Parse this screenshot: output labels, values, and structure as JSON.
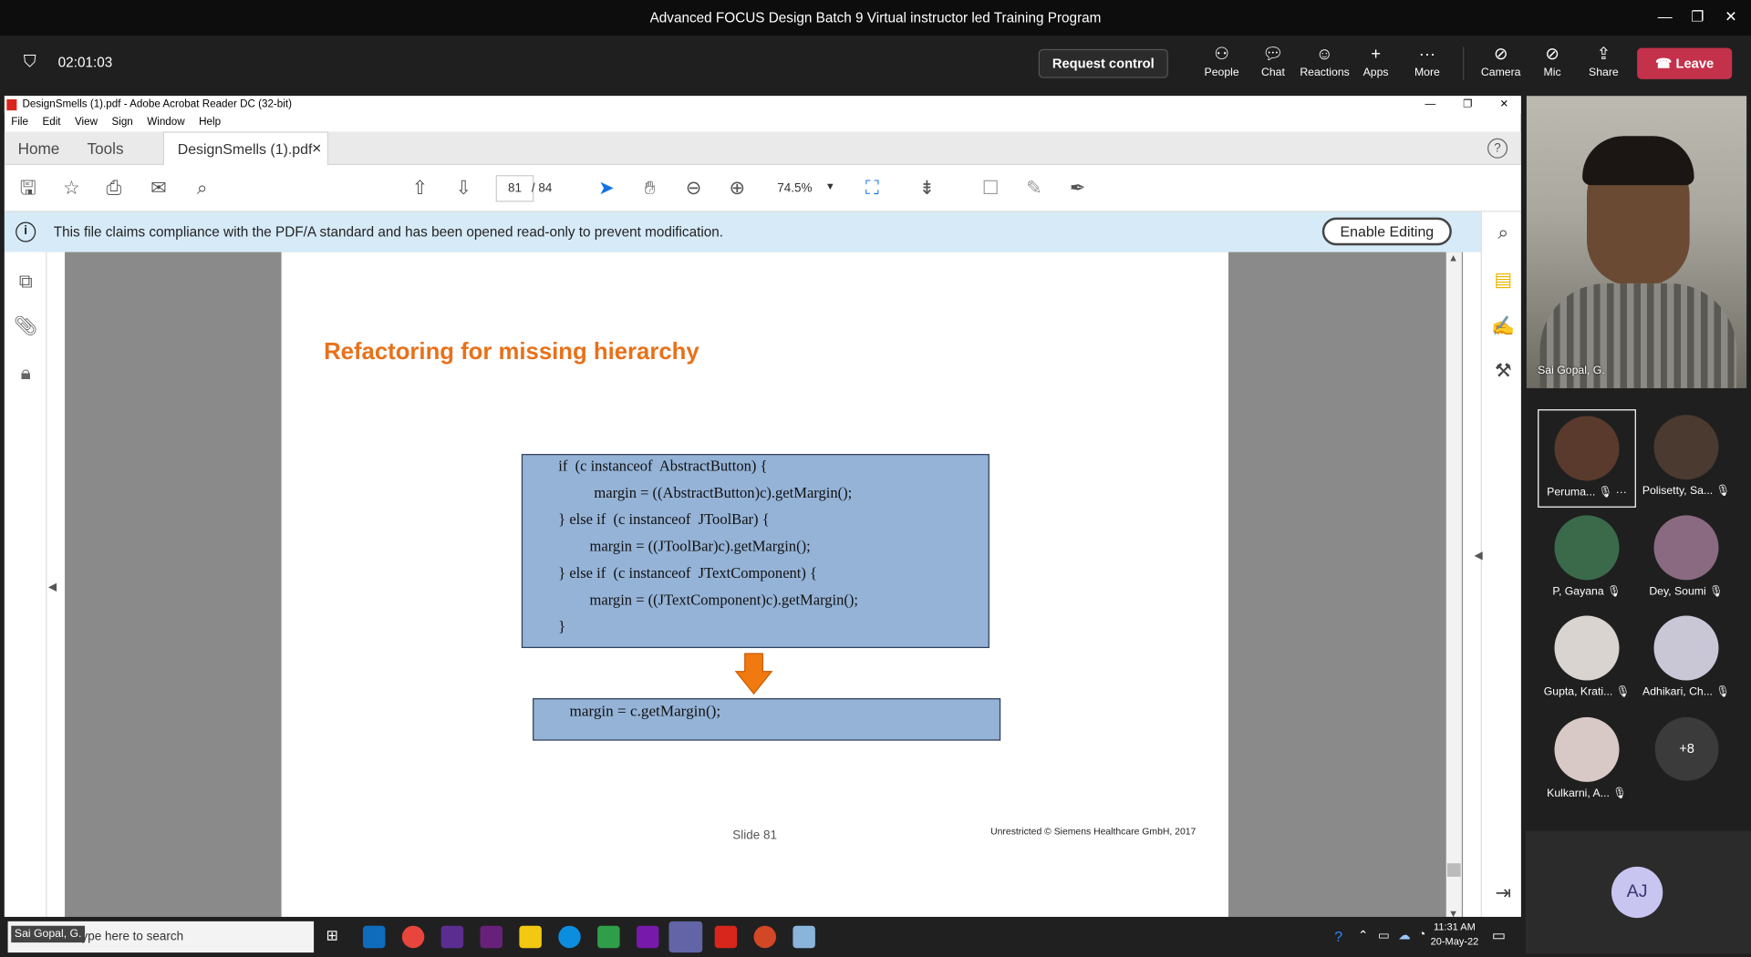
{
  "teams": {
    "window_title": "Advanced FOCUS Design Batch 9 Virtual instructor led Training Program",
    "timer": "02:01:03",
    "request_control": "Request control",
    "toolbar": {
      "people": "People",
      "chat": "Chat",
      "reactions": "Reactions",
      "apps": "Apps",
      "more": "More",
      "camera": "Camera",
      "mic": "Mic",
      "share": "Share",
      "leave": "Leave"
    }
  },
  "acrobat": {
    "title": "DesignSmells (1).pdf - Adobe Acrobat Reader DC (32-bit)",
    "menu": [
      "File",
      "Edit",
      "View",
      "Sign",
      "Window",
      "Help"
    ],
    "tabs": {
      "home": "Home",
      "tools": "Tools",
      "doc": "DesignSmells (1).pdf"
    },
    "page_current": "81",
    "page_total": "/ 84",
    "zoom": "74.5%",
    "notice": "This file claims compliance with the PDF/A standard and has been opened read-only to prevent modification.",
    "enable_editing": "Enable Editing"
  },
  "slide": {
    "title": "Refactoring for missing hierarchy",
    "code_lines": [
      "if  (c instanceof  AbstractButton) {",
      "margin = ((AbstractButton)c).getMargin();",
      "} else if  (c instanceof  JToolBar) {",
      "margin = ((JToolBar)c).getMargin();",
      "} else if  (c instanceof  JTextComponent) {",
      "margin = ((JTextComponent)c).getMargin();",
      "}"
    ],
    "refactored": "margin = c.getMargin();",
    "slide_number": "Slide 81",
    "copyright": "Unrestricted © Siemens Healthcare GmbH, 2017"
  },
  "participants": {
    "presenter": "Sai Gopal, G.",
    "tiles": [
      "Peruma...",
      "Polisetty, Sa...",
      "P, Gayana",
      "Dey, Soumi",
      "Gupta, Krati...",
      "Adhikari, Ch...",
      "Kulkarni, A..."
    ],
    "more_count": "+8",
    "self_initials": "AJ"
  },
  "taskbar": {
    "search_placeholder": "Type here to search",
    "presenter_label": "Sai Gopal, G.",
    "time": "11:31 AM",
    "date": "20-May-22"
  },
  "colors": {
    "accent_orange": "#e8711a",
    "leave_red": "#c4314b",
    "code_box": "#95b3d7",
    "notice_bg": "#d6eaf8"
  }
}
